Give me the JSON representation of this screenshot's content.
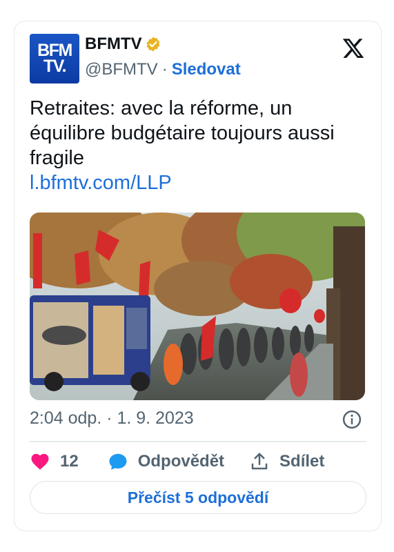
{
  "author": {
    "avatar_line1": "BFM",
    "avatar_line2": "TV.",
    "name": "BFMTV",
    "handle": "@BFMTV",
    "separator": "·",
    "follow_label": "Sledovat",
    "verified_color": "#e8b422"
  },
  "tweet": {
    "text": "Retraites: avec la réforme, un équilibre budgétaire toujours aussi fragile",
    "link": "l.bfmtv.com/LLP",
    "media_icon": "protest-photo",
    "timestamp": "2:04 odp. · 1. 9. 2023"
  },
  "actions": {
    "like_count": "12",
    "reply_label": "Odpovědět",
    "share_label": "Sdílet"
  },
  "read_replies_label": "Přečíst 5 odpovědí",
  "colors": {
    "accent": "#1d6fd8",
    "like": "#f91880",
    "reply_icon": "#1d9bf0",
    "brand_blue": "#1b56c5"
  }
}
